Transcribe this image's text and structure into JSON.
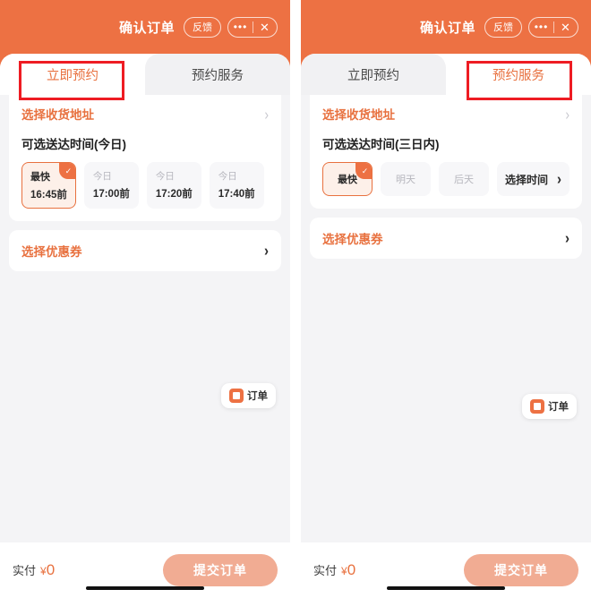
{
  "header": {
    "title": "确认订单",
    "feedback_label": "反馈",
    "more_icon": "•••",
    "close_icon": "✕"
  },
  "panels": [
    {
      "id": "left",
      "tabs": [
        {
          "label": "立即预约",
          "active": true
        },
        {
          "label": "预约服务",
          "active": false
        }
      ],
      "highlight_tab_index": 0,
      "address": {
        "label": "选择收货地址",
        "chevron": "›"
      },
      "delivery": {
        "title": "可选送达时间(今日)",
        "chips": [
          {
            "line1": "最快",
            "line2": "16:45前",
            "selected": true,
            "check": "✓"
          },
          {
            "line1": "今日",
            "line2": "17:00前",
            "selected": false
          },
          {
            "line1": "今日",
            "line2": "17:20前",
            "selected": false
          },
          {
            "line1": "今日",
            "line2": "17:40前",
            "selected": false
          }
        ]
      },
      "coupon": {
        "label": "选择优惠券",
        "chevron": "›"
      },
      "fab": {
        "label": "订单",
        "icon": "order-icon"
      },
      "bottom": {
        "pay_label": "实付",
        "currency": "¥",
        "amount": "0",
        "submit_label": "提交订单"
      }
    },
    {
      "id": "right",
      "tabs": [
        {
          "label": "立即预约",
          "active": false
        },
        {
          "label": "预约服务",
          "active": true
        }
      ],
      "highlight_tab_index": 1,
      "address": {
        "label": "选择收货地址",
        "chevron": "›"
      },
      "delivery": {
        "title": "可选送达时间(三日内)",
        "chips": [
          {
            "line1": "最快",
            "selected": true,
            "check": "✓"
          },
          {
            "line1": "明天",
            "selected": false
          },
          {
            "line1": "后天",
            "selected": false
          }
        ],
        "picker": {
          "label": "选择时间",
          "chevron": "›"
        }
      },
      "coupon": {
        "label": "选择优惠券",
        "chevron": "›"
      },
      "fab": {
        "label": "订单",
        "icon": "order-icon"
      },
      "bottom": {
        "pay_label": "实付",
        "currency": "¥",
        "amount": "0",
        "submit_label": "提交订单"
      }
    }
  ],
  "colors": {
    "brand_orange": "#ED7143",
    "text_orange": "#E8713F",
    "submit_disabled": "#F1AC93",
    "annotation_red": "#ee1c23",
    "page_bg": "#f4f4f6"
  }
}
